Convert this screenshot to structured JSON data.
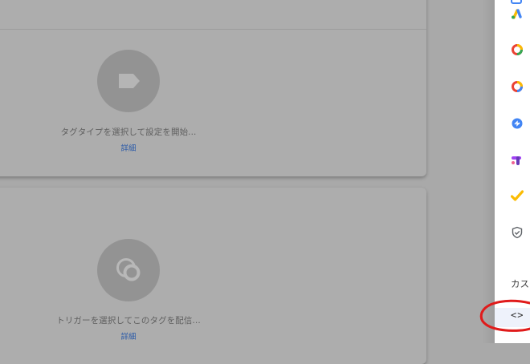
{
  "tag_card": {
    "prompt": "タグタイプを選択して設定を開始...",
    "more_link": "詳細",
    "icon": "tag-icon"
  },
  "trigger_card": {
    "prompt": "トリガーを選択してこのタグを配信...",
    "more_link": "詳細",
    "icon": "trigger-icon"
  },
  "side_panel": {
    "icons": [
      "google-ads-icon",
      "google-analytics-icon",
      "google-analytics-icon-2",
      "floodlight-icon",
      "google-optimize-icon",
      "google-surveys-icon",
      "shield-check-icon"
    ],
    "section_label": "カス",
    "custom_html_icon_text": "<>"
  },
  "colors": {
    "overlay": "#a9a9a9",
    "link": "#2a5aa8",
    "highlight_circle": "#e01b1b"
  }
}
